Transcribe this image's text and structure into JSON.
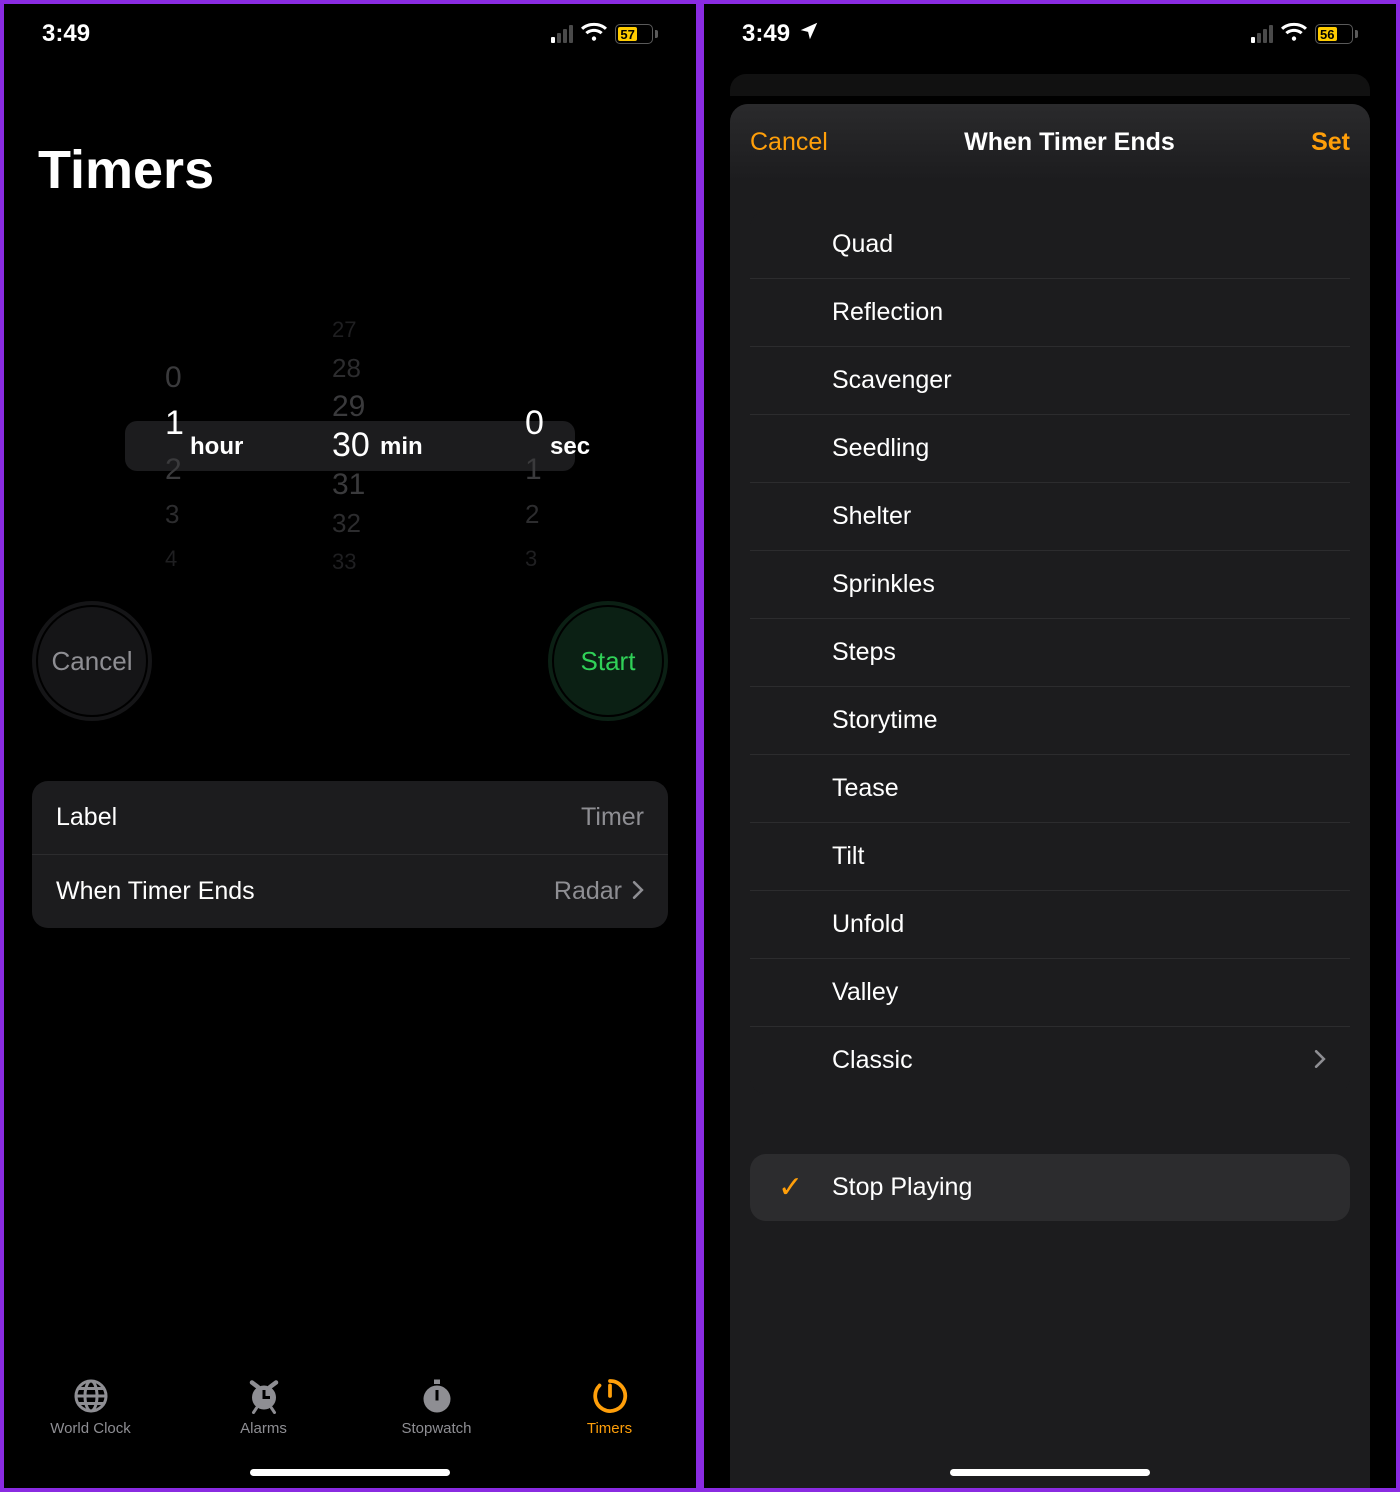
{
  "left": {
    "status": {
      "time": "3:49",
      "battery": "57"
    },
    "title": "Timers",
    "picker": {
      "hours": {
        "label": "hour",
        "sel": "1",
        "above": [
          "0"
        ],
        "below": [
          "2",
          "3",
          "4"
        ]
      },
      "mins": {
        "label": "min",
        "sel": "30",
        "above": [
          "27",
          "28",
          "29"
        ],
        "below": [
          "31",
          "32",
          "33"
        ]
      },
      "secs": {
        "label": "sec",
        "sel": "0",
        "above": [],
        "below": [
          "1",
          "2",
          "3"
        ]
      }
    },
    "actions": {
      "cancel": "Cancel",
      "start": "Start"
    },
    "settings": {
      "label_row": {
        "title": "Label",
        "value": "Timer"
      },
      "ends_row": {
        "title": "When Timer Ends",
        "value": "Radar"
      }
    },
    "tabs": [
      "World Clock",
      "Alarms",
      "Stopwatch",
      "Timers"
    ]
  },
  "right": {
    "status": {
      "time": "3:49",
      "battery": "56"
    },
    "modal": {
      "cancel": "Cancel",
      "title": "When Timer Ends",
      "set": "Set",
      "sounds": [
        "Quad",
        "Reflection",
        "Scavenger",
        "Seedling",
        "Shelter",
        "Sprinkles",
        "Steps",
        "Storytime",
        "Tease",
        "Tilt",
        "Unfold",
        "Valley",
        "Classic"
      ],
      "stop_playing": "Stop Playing"
    }
  }
}
